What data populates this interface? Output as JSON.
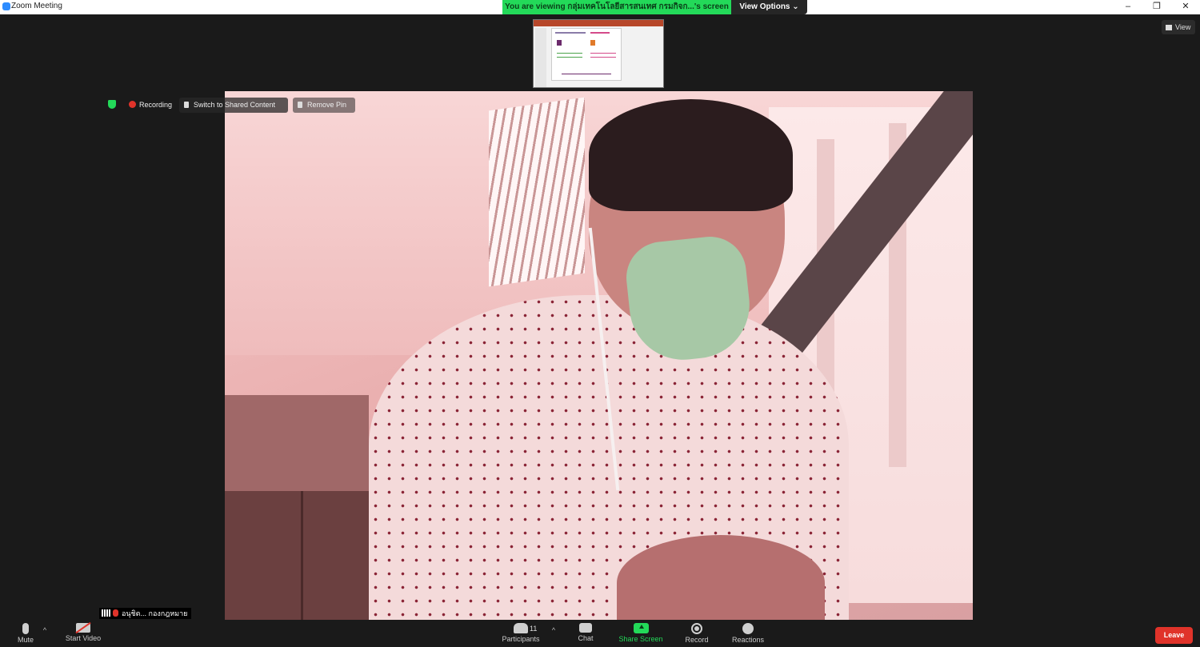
{
  "window": {
    "title": "Zoom Meeting",
    "minimize_glyph": "–",
    "maximize_glyph": "❐",
    "close_glyph": "✕"
  },
  "share_banner": {
    "text": "You are viewing กลุ่มเทคโนโลยีสารสนเทศ กรมกิจก...'s screen",
    "view_options": "View Options ⌄",
    "color": "#23d959"
  },
  "view_button": {
    "label": "View"
  },
  "video_overlay": {
    "recording": "Recording",
    "switch_shared": "Switch to Shared Content",
    "remove_pin": "Remove Pin",
    "shield_color": "#23d959",
    "recording_color": "#e0332a"
  },
  "participant_name": "อนุชิต... กองกฎหมาย",
  "toolbar": {
    "mute": "Mute",
    "start_video": "Start Video",
    "participants": "Participants",
    "participants_count": "11",
    "chat": "Chat",
    "share_screen": "Share Screen",
    "record": "Record",
    "reactions": "Reactions",
    "leave": "Leave",
    "caret": "^"
  },
  "colors": {
    "background": "#1a1a1a",
    "leave": "#e0332a",
    "accent_green": "#23d959"
  },
  "icons": [
    "zoom-logo-icon",
    "shield-icon",
    "record-dot-icon",
    "pin-icon",
    "grid-icon",
    "signal-icon",
    "mic-muted-icon",
    "mic-icon",
    "camera-off-icon",
    "participants-icon",
    "chat-icon",
    "share-screen-icon",
    "record-icon",
    "reactions-icon"
  ]
}
